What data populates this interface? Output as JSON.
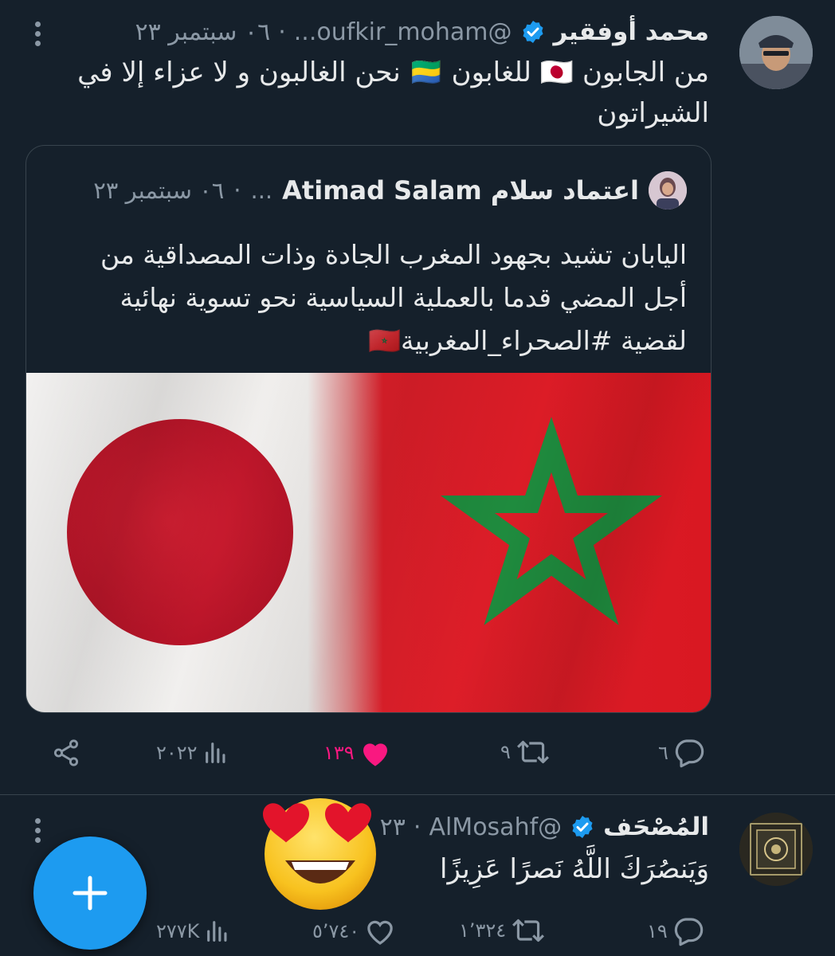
{
  "tweet1": {
    "name": "محمد أوفقير",
    "handle": "@oufkir_moham...",
    "dot": "·",
    "date": "٠٦ سبتمبر ٢٣",
    "text_line1": "من الجابون 🇯🇵 للغابون 🇬🇦 نحن الغالبون و لا عزاء إلا في",
    "text_line2": "الشيراتون",
    "quote": {
      "name": "اعتماد سلام Atimad Salam",
      "handle": "...",
      "dot": "·",
      "date": "٠٦ سبتمبر ٢٣",
      "text_line1": "اليابان تشيد بجهود المغرب الجادة وذات المصداقية من",
      "text_line2": "أجل المضي قدما بالعملية السياسية نحو تسوية نهائية",
      "text_line3": "لقضية #الصحراء_المغربية🇲🇦"
    },
    "actions": {
      "replies": "٦",
      "retweets": "٩",
      "likes": "١٣٩",
      "views": "٢٠٢٢"
    }
  },
  "tweet2": {
    "name": "المُصْحَف",
    "handle": "@AlMosahf",
    "dot": "·",
    "date": "٢٣",
    "text": "وَيَنصُرَكَ اللَّهُ نَصرًا عَزِيزًا",
    "actions": {
      "replies": "١٩",
      "retweets": "١٬٣٢٤",
      "likes": "٥٬٧٤٠",
      "views": "٢٧٧K"
    }
  },
  "fab": {
    "icon": "plus-icon"
  },
  "colors": {
    "background": "#15202b",
    "accent": "#1d9bf0",
    "like": "#f91880",
    "muted": "#8b98a5",
    "text": "#e7e9ea"
  }
}
